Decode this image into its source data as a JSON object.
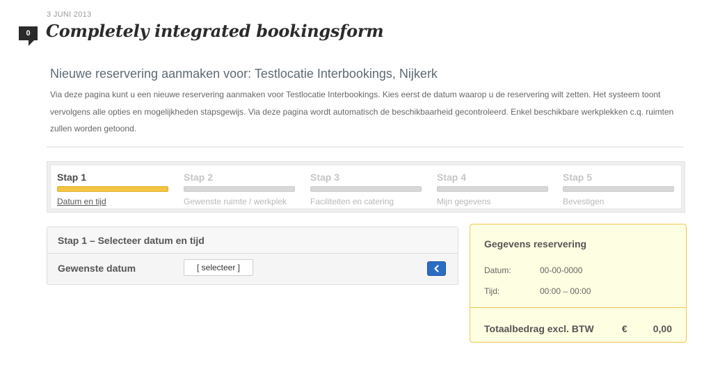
{
  "post": {
    "date": "3 JUNI 2013",
    "comment_count": "0",
    "title": "Completely integrated bookingsform"
  },
  "intro": {
    "heading": "Nieuwe reservering aanmaken voor: Testlocatie Interbookings, Nijkerk",
    "text": "Via deze pagina kunt u een nieuwe reservering aanmaken voor Testlocatie Interbookings. Kies eerst de datum waarop u de reservering wilt zetten. Het systeem toont vervolgens alle opties en mogelijkheden stapsgewijs. Via deze pagina wordt automatisch de beschikbaarheid gecontroleerd. Enkel beschikbare werkplekken c.q. ruimten zullen worden getoond."
  },
  "steps": [
    {
      "title": "Stap 1",
      "label": "Datum en tijd",
      "active": true
    },
    {
      "title": "Stap 2",
      "label": "Gewenste ruimte / werkplek",
      "active": false
    },
    {
      "title": "Stap 3",
      "label": "Faciliteiten en catering",
      "active": false
    },
    {
      "title": "Stap 4",
      "label": "Mijn gegevens",
      "active": false
    },
    {
      "title": "Stap 5",
      "label": "Bevestigen",
      "active": false
    }
  ],
  "form": {
    "header": "Stap 1  –  Selecteer datum en tijd",
    "date_label": "Gewenste datum",
    "date_button": "[ selecteer ]",
    "nav_icon": "chevron-left-icon"
  },
  "summary": {
    "title": "Gegevens reservering",
    "date_label": "Datum:",
    "date_value": "00-00-0000",
    "time_label": "Tijd:",
    "time_value": "00:00 – 00:00",
    "total_label": "Totaalbedrag excl. BTW",
    "currency": "€",
    "total_value": "0,00"
  },
  "colors": {
    "accent_yellow": "#f4c542",
    "button_blue": "#2b6cc4",
    "summary_background": "#fefee2",
    "summary_border": "#f0c64e"
  }
}
